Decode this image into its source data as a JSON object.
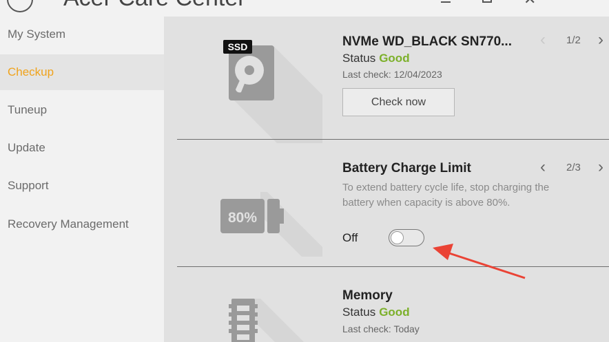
{
  "app": {
    "title": "Acer Care Center"
  },
  "sidebar": {
    "items": [
      {
        "label": "My System"
      },
      {
        "label": "Checkup"
      },
      {
        "label": "Tuneup"
      },
      {
        "label": "Update"
      },
      {
        "label": "Support"
      },
      {
        "label": "Recovery Management"
      }
    ],
    "active": "Checkup"
  },
  "cards": {
    "storage": {
      "icon": "ssd-drive-icon",
      "icon_badge": "SSD",
      "title": "NVMe WD_BLACK SN770...",
      "status_label": "Status",
      "status_value": "Good",
      "last_check": "Last check: 12/04/2023",
      "button": "Check now",
      "pager": "1/2"
    },
    "battery": {
      "icon": "battery-80-icon",
      "icon_text": "80%",
      "title": "Battery Charge Limit",
      "description": "To extend battery cycle life, stop charging the battery when capacity is above 80%.",
      "toggle_label": "Off",
      "toggle_on": false,
      "pager": "2/3"
    },
    "memory": {
      "icon": "memory-module-icon",
      "title": "Memory",
      "status_label": "Status",
      "status_value": "Good",
      "last_check": "Last check: Today"
    }
  },
  "colors": {
    "accent": "#f0a31c",
    "good": "#7cb02a",
    "annotation": "#ea4335"
  }
}
